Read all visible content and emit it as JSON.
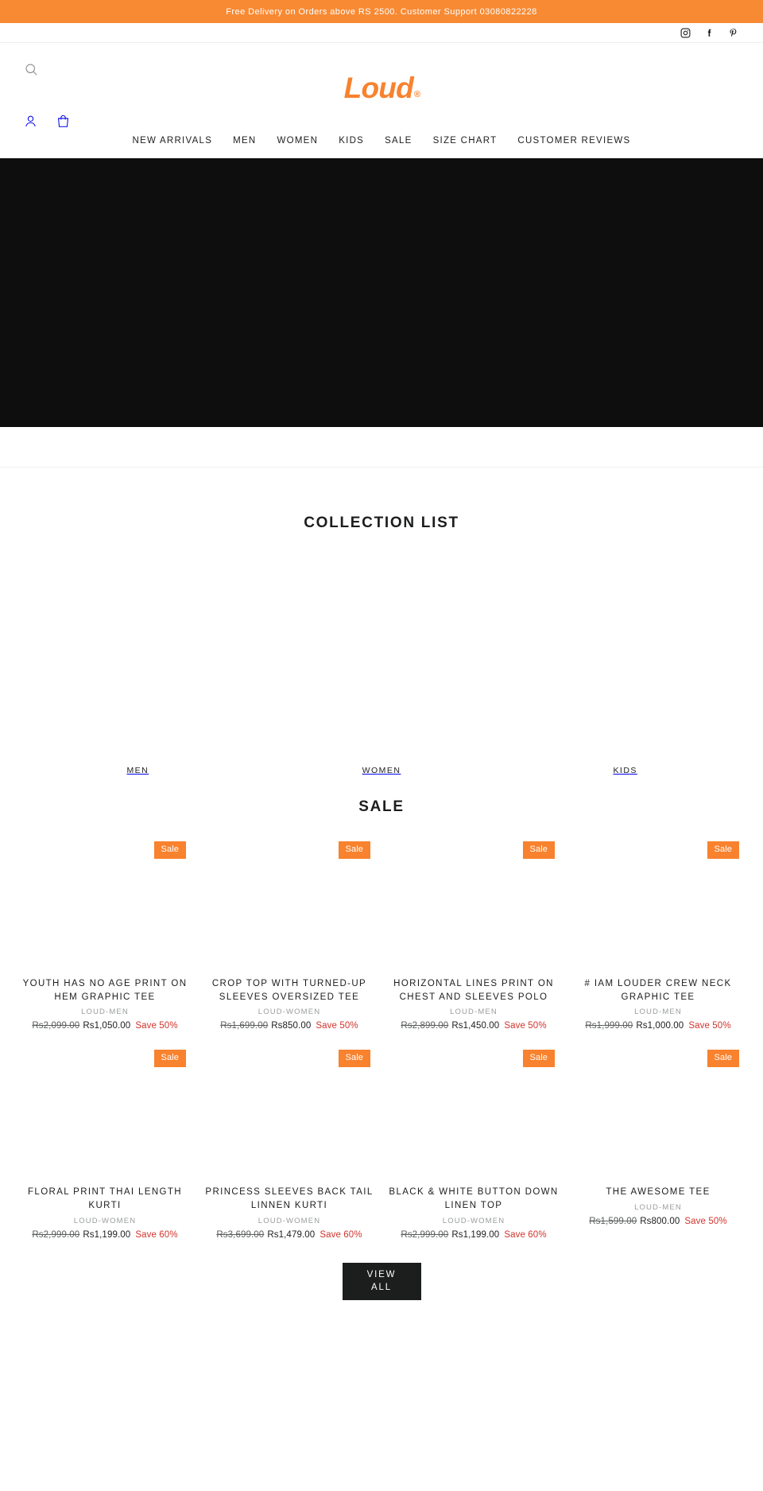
{
  "announcement": {
    "text": "Free Delivery on Orders above RS 2500. Customer Support 03080822228",
    "bg_color": "#f88a33"
  },
  "social": [
    {
      "name": "instagram-icon",
      "label": "Instagram"
    },
    {
      "name": "facebook-icon",
      "label": "Facebook"
    },
    {
      "name": "pinterest-icon",
      "label": "Pinterest"
    }
  ],
  "header": {
    "logo_text": "Loud",
    "logo_reg": "®",
    "logo_color": "#f8822e",
    "search_label": "Search",
    "account_label": "Log in",
    "cart_label": "Cart",
    "nav": [
      {
        "label": "NEW ARRIVALS"
      },
      {
        "label": "MEN"
      },
      {
        "label": "WOMEN"
      },
      {
        "label": "KIDS"
      },
      {
        "label": "SALE"
      },
      {
        "label": "SIZE CHART"
      },
      {
        "label": "CUSTOMER REVIEWS"
      }
    ]
  },
  "collection_section": {
    "title": "COLLECTION LIST",
    "items": [
      {
        "label": "MEN"
      },
      {
        "label": "WOMEN"
      },
      {
        "label": "KIDS"
      }
    ]
  },
  "sale_section": {
    "title": "SALE",
    "badge_label": "Sale",
    "badge_color": "#f8822e",
    "save_color": "#d0342c",
    "view_all_line1": "VIEW",
    "view_all_line2": "ALL",
    "products": [
      {
        "title": "YOUTH HAS NO AGE PRINT ON HEM GRAPHIC TEE",
        "vendor": "LOUD-MEN",
        "compare_price": "Rs2,099.00",
        "price": "Rs1,050.00",
        "save": "Save 50%",
        "badge": "Sale"
      },
      {
        "title": "CROP TOP WITH TURNED-UP SLEEVES OVERSIZED TEE",
        "vendor": "LOUD-WOMEN",
        "compare_price": "Rs1,699.00",
        "price": "Rs850.00",
        "save": "Save 50%",
        "badge": "Sale"
      },
      {
        "title": "HORIZONTAL LINES PRINT ON CHEST AND SLEEVES POLO",
        "vendor": "LOUD-MEN",
        "compare_price": "Rs2,899.00",
        "price": "Rs1,450.00",
        "save": "Save 50%",
        "badge": "Sale"
      },
      {
        "title": "# IAM LOUDER CREW NECK GRAPHIC TEE",
        "vendor": "LOUD-MEN",
        "compare_price": "Rs1,999.00",
        "price": "Rs1,000.00",
        "save": "Save 50%",
        "badge": "Sale"
      },
      {
        "title": "FLORAL PRINT THAI LENGTH KURTI",
        "vendor": "LOUD-WOMEN",
        "compare_price": "Rs2,999.00",
        "price": "Rs1,199.00",
        "save": "Save 60%",
        "badge": "Sale"
      },
      {
        "title": "PRINCESS SLEEVES BACK TAIL LINNEN KURTI",
        "vendor": "LOUD-WOMEN",
        "compare_price": "Rs3,699.00",
        "price": "Rs1,479.00",
        "save": "Save 60%",
        "badge": "Sale"
      },
      {
        "title": "BLACK & WHITE BUTTON DOWN LINEN TOP",
        "vendor": "LOUD-WOMEN",
        "compare_price": "Rs2,999.00",
        "price": "Rs1,199.00",
        "save": "Save 60%",
        "badge": "Sale"
      },
      {
        "title": "THE AWESOME TEE",
        "vendor": "LOUD-MEN",
        "compare_price": "Rs1,599.00",
        "price": "Rs800.00",
        "save": "Save 50%",
        "badge": "Sale"
      }
    ]
  }
}
